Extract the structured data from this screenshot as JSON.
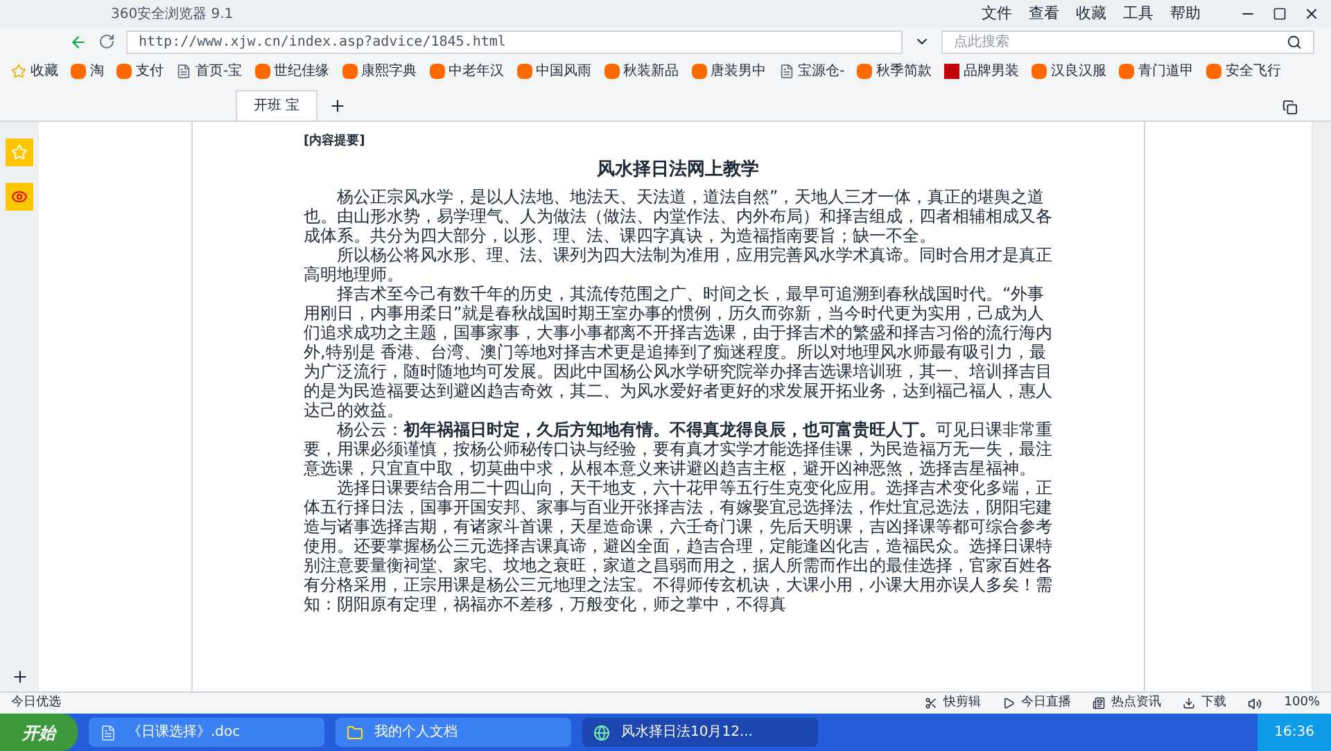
{
  "window": {
    "title": "360安全浏览器 9.1",
    "menu": [
      "文件",
      "查看",
      "收藏",
      "工具",
      "帮助"
    ]
  },
  "address": {
    "url": "http://www.xjw.cn/index.asp?advice/1845.html",
    "search_placeholder": "点此搜索"
  },
  "bookmarks": [
    {
      "label": "收藏",
      "kind": "menu"
    },
    {
      "label": "淘",
      "kind": "site"
    },
    {
      "label": "支付",
      "kind": "site"
    },
    {
      "label": "首页-宝",
      "kind": "page"
    },
    {
      "label": "世纪佳缘",
      "kind": "site"
    },
    {
      "label": "康熙字典",
      "kind": "site"
    },
    {
      "label": "中老年汉",
      "kind": "site"
    },
    {
      "label": "中国风雨",
      "kind": "site"
    },
    {
      "label": "秋装新品",
      "kind": "site"
    },
    {
      "label": "唐装男中",
      "kind": "site"
    },
    {
      "label": "宝源仓-",
      "kind": "page"
    },
    {
      "label": "秋季简款",
      "kind": "site"
    },
    {
      "label": "品牌男装",
      "kind": "brand"
    },
    {
      "label": "汉良汉服",
      "kind": "site"
    },
    {
      "label": "青门道甲",
      "kind": "site"
    },
    {
      "label": "安全飞行",
      "kind": "site"
    }
  ],
  "tabs": [
    {
      "label": "开班 宝",
      "selected": true
    }
  ],
  "document": {
    "section_label": "[内容提要]",
    "title": "风水择日法网上教学",
    "paragraphs": [
      "杨公正宗风水学，是以人法地、地法天、天法道，道法自然”，天地人三才一体，真正的堪舆之道也。由山形水势，易学理气、人为做法（做法、内堂作法、内外布局）和择吉组成，四者相辅相成又各成体系。共分为四大部分，以形、理、法、课四字真诀，为造福指南要旨；缺一不全。",
      "所以杨公将风水形、理、法、课列为四大法制为准用，应用完善风水学术真谛。同时合用才是真正高明地理师。",
      "择吉术至今己有数千年的历史，其流传范围之广、时间之长，最早可追溯到春秋战国时代。“外事用刚日，内事用柔日”就是春秋战国时期王室办事的惯例，历久而弥新，当今时代更为实用，己成为人们追求成功之主题，国事家事，大事小事都离不开择吉选课，由于择吉术的繁盛和择吉习俗的流行海内外,特别是 香港、台湾、澳门等地对择吉术更是追捧到了痴迷程度。所以对地理风水师最有吸引力，最为广泛流行，随时随地均可发展。因此中国杨公风水学研究院举办择吉选课培训班，其一、培训择吉目的是为民造福要达到避凶趋吉奇效，其二、为风水爱好者更好的求发展开拓业务，达到福己福人，惠人达己的效益。",
      "杨公云：**初年祸福日时定，久后方知地有情。不得真龙得良辰，也可富贵旺人丁。**可见日课非常重要，用课必须谨慎，按杨公师秘传口诀与经验，要有真才实学才能选择佳课，为民造福万无一失，最注意选课，只宜直中取，切莫曲中求，从根本意义来讲避凶趋吉主枢，避开凶神恶煞，选择吉星福神。",
      "选择日课要结合用二十四山向，天干地支，六十花甲等五行生克变化应用。选择吉术变化多端，正体五行择日法，国事开国安邦、家事与百业开张择吉法，有嫁娶宜忌选择法，作灶宜忌选法，阴阳宅建造与诸事选择吉期，有诸家斗首课，天星造命课，六壬奇门课，先后天明课，吉凶择课等都可综合参考使用。还要掌握杨公三元选择吉课真谛，避凶全面，趋吉合理，定能逢凶化吉，造福民众。选择日课特别注意要量衡祠堂、家宅、坟地之衰旺，家道之昌弱而用之，据人所需而作出的最佳选择，官家百姓各有分格采用，正宗用课是杨公三元地理之法宝。不得师传玄机诀，大课小用，小课大用亦误人多矣！需知：阴阳原有定理，祸福亦不差移，万般变化，师之掌中，不得真"
    ]
  },
  "status_bar": {
    "left": "今日优选",
    "items": [
      "快剪辑",
      "今日直播",
      "热点资讯",
      "下载"
    ],
    "zoom": "100%"
  },
  "taskbar": {
    "start": "开始",
    "tasks": [
      {
        "label": "《日课选择》.doc",
        "kind": "doc",
        "selected": false
      },
      {
        "label": "我的个人文档",
        "kind": "folder",
        "selected": false
      },
      {
        "label": "风水择日法10月12...",
        "kind": "browser",
        "selected": true
      }
    ],
    "time": "16:36"
  }
}
